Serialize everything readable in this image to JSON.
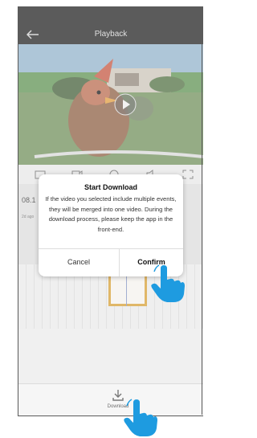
{
  "header": {
    "title": "Playback"
  },
  "timeline": {
    "date": "08.1",
    "sub": "2d ago"
  },
  "dialog": {
    "title": "Start Download",
    "message": "If the video you selected include multiple events, they will be merged into one video. During the download process, please keep the app in the front-end.",
    "cancel": "Cancel",
    "confirm": "Confirm"
  },
  "bottom": {
    "download_label": "Download"
  },
  "colors": {
    "accent_hand": "#1e9be0",
    "clip_border": "#d49b2e",
    "header_bg": "#1c1c1c"
  }
}
